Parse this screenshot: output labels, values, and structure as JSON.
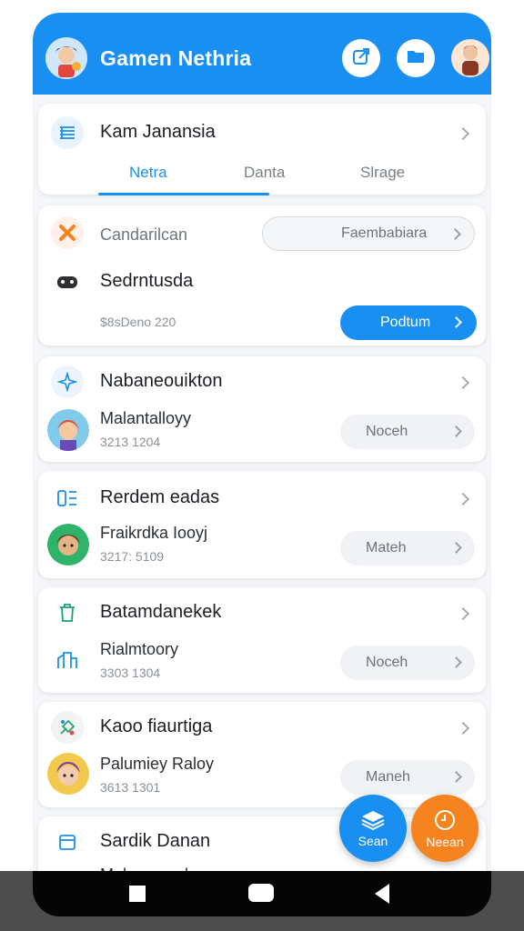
{
  "header": {
    "title": "Gamen Nethria",
    "icons": [
      "avatar-icon",
      "share-icon",
      "folder-icon",
      "profile-icon"
    ]
  },
  "card1": {
    "title": "Kam Janansia",
    "tabs": [
      {
        "label": "Netra",
        "active": true
      },
      {
        "label": "Danta",
        "active": false
      },
      {
        "label": "Slrage",
        "active": false
      }
    ]
  },
  "card2": {
    "row1_label": "Candarilcan",
    "row1_pill": "Faembabiara",
    "row2_title": "Sedrntusda",
    "row3_meta": "$8sDeno 220",
    "action": "Podtum"
  },
  "items": [
    {
      "title": "Nabaneouikton",
      "game": "Malantalloyy",
      "meta": "3213 1204",
      "button": "Noceh"
    },
    {
      "title": "Rerdem eadas",
      "game": "Fraikrdka Iooyj",
      "meta": "3217: 5109",
      "button": "Mateh"
    },
    {
      "title": "Batamdanekek",
      "game": "Rialmtoory",
      "meta": "3303 1304",
      "button": "Noceh"
    },
    {
      "title": "Kaoo fiaurtiga",
      "game": "Palumiey Raloy",
      "meta": "3613 1301",
      "button": "Maneh"
    },
    {
      "title": "Sardik Danan",
      "game": "Malu ..saaal",
      "meta": "",
      "button": ""
    }
  ],
  "fabs": {
    "left_label": "Sean",
    "right_label": "Neean",
    "left_color": "#1a8ff2",
    "right_color": "#f5831f"
  },
  "colors": {
    "accent": "#1a8ff2",
    "orange": "#f5831f"
  }
}
